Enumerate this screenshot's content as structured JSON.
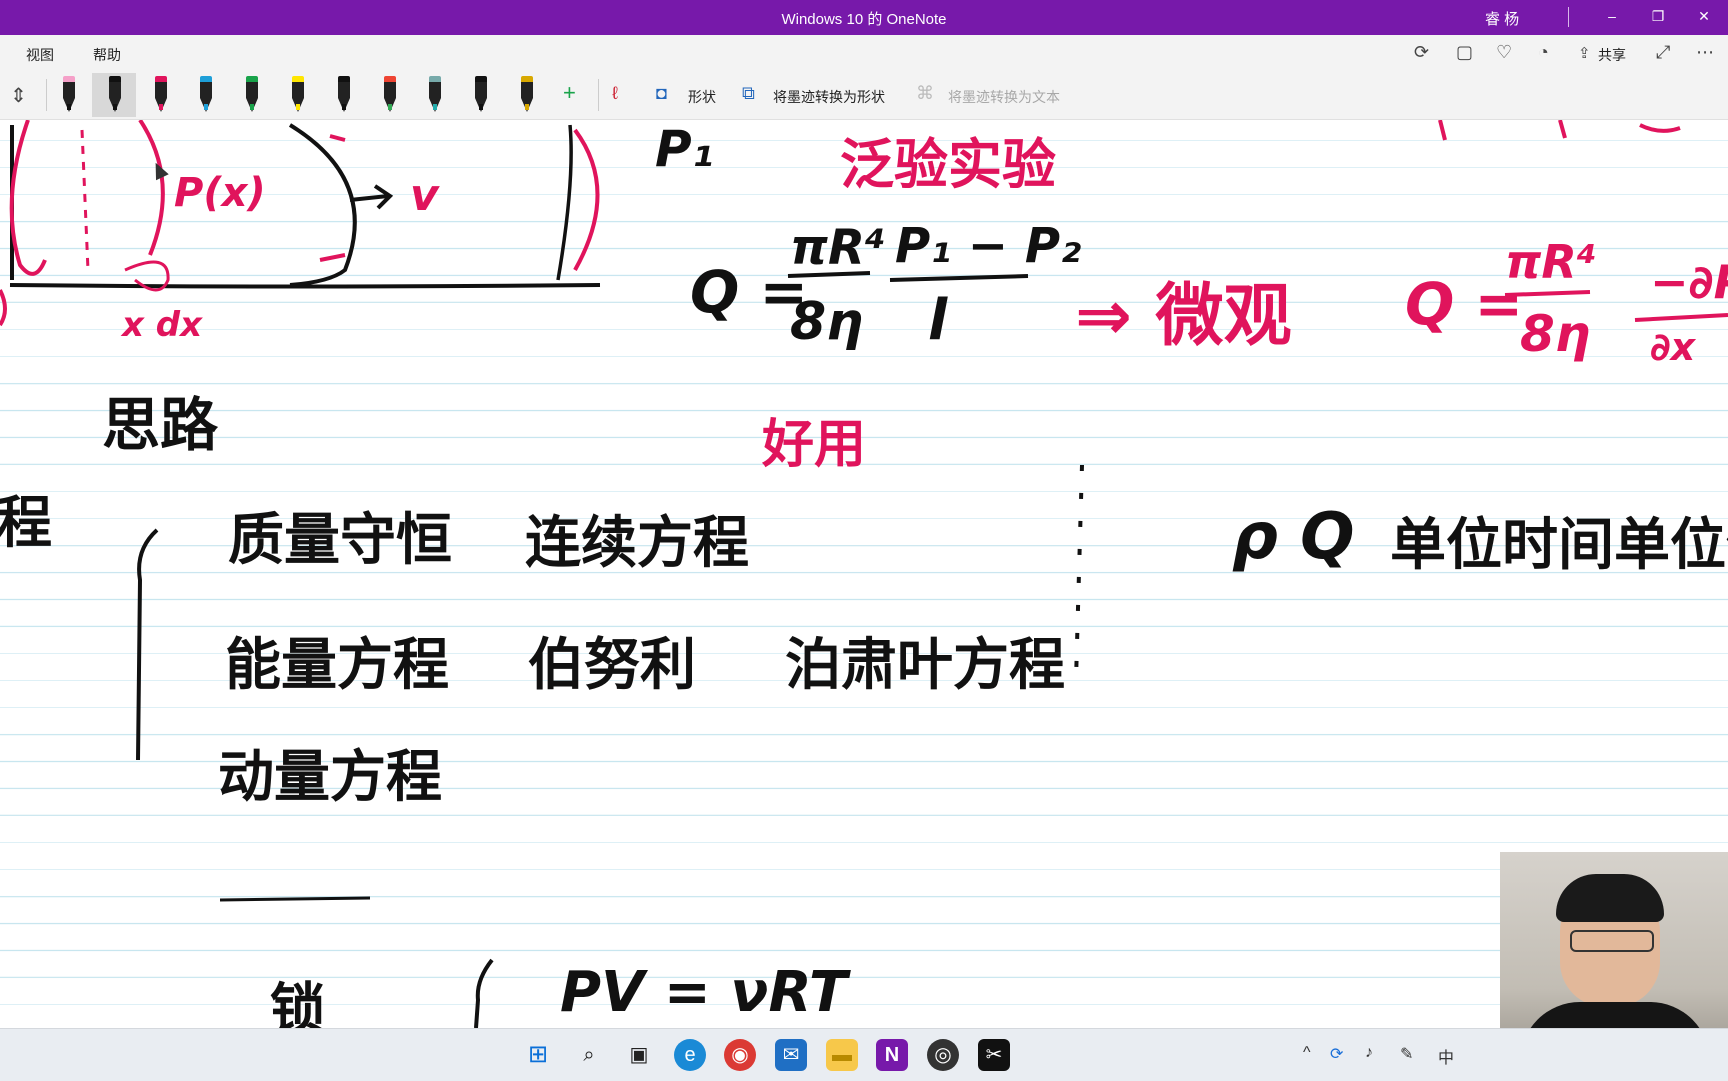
{
  "titlebar": {
    "title": "Windows 10 的 OneNote",
    "user": "睿 杨",
    "minimize": "–",
    "restore": "❐",
    "close": "✕"
  },
  "menu": {
    "items": [
      "视图",
      "帮助"
    ],
    "share": "共享"
  },
  "toolbar": {
    "shapes_label": "形状",
    "ink_to_shape_label": "将墨迹转换为形状",
    "ink_to_text_label": "将墨迹转换为文本",
    "add_pen": "+",
    "pens": [
      {
        "name": "pen-black-pink",
        "cap": "#f5a0c8",
        "nib": "#111"
      },
      {
        "name": "pen-black-selected",
        "cap": "#111",
        "nib": "#111"
      },
      {
        "name": "pen-magenta",
        "cap": "#e0145c",
        "nib": "#e0145c"
      },
      {
        "name": "pen-cyan",
        "cap": "#1e9fd8",
        "nib": "#1e9fd8"
      },
      {
        "name": "pen-green",
        "cap": "#19a34a",
        "nib": "#19a34a"
      },
      {
        "name": "highlighter-yellow",
        "cap": "#ffe600",
        "nib": "#ffe600"
      },
      {
        "name": "pen-galaxy",
        "cap": "#111",
        "nib": "#111"
      },
      {
        "name": "pen-rainbow",
        "cap": "#e43",
        "nib": "#3a5"
      },
      {
        "name": "pen-ocean",
        "cap": "#7aa",
        "nib": "#2aa"
      },
      {
        "name": "pen-black-2",
        "cap": "#111",
        "nib": "#111"
      },
      {
        "name": "pen-gold",
        "cap": "#d8a800",
        "nib": "#d8a800"
      }
    ]
  },
  "notes": {
    "black": {
      "p1": "P₁",
      "q_eq": "Q =",
      "frac1_num": "πR⁴",
      "frac1_den": "8η",
      "frac2_num": "P₁ − P₂",
      "frac2_den": "l",
      "silu": "思路",
      "cheng": "程",
      "zhiliang": "质量守恒",
      "lianxu": "连续方程",
      "nengliang": "能量方程",
      "bonuli": "伯努利",
      "boxiaoye": "泊肃叶方程",
      "dongliang": "动量方程",
      "rho_q": "ρ Q",
      "danwei": "单位时间单位体",
      "suo": "锁",
      "pv": "PV = νRT"
    },
    "pink": {
      "px": "P(x)",
      "v": "v",
      "shiyan": "泛验实验",
      "arrow_wei": "⇒ 微观",
      "q_eq2": "Q =",
      "frac3_num": "πR⁴",
      "frac3_den": "8η",
      "frac4_num": "−∂P",
      "frac4_den": "∂x",
      "haoyong": "好用",
      "x_dx": "x  dx"
    }
  },
  "taskbar": {
    "icons": [
      "windows-start",
      "search",
      "task-view",
      "edge",
      "chrome",
      "mail",
      "file-explorer",
      "onenote",
      "obs",
      "capcut"
    ],
    "tray": {
      "chevron": "^",
      "ime": "中"
    }
  },
  "colors": {
    "title_bg": "#7719aa",
    "ink_pink": "#e0145c",
    "ink_black": "#111111",
    "rule_line": "#c8e6ef"
  }
}
